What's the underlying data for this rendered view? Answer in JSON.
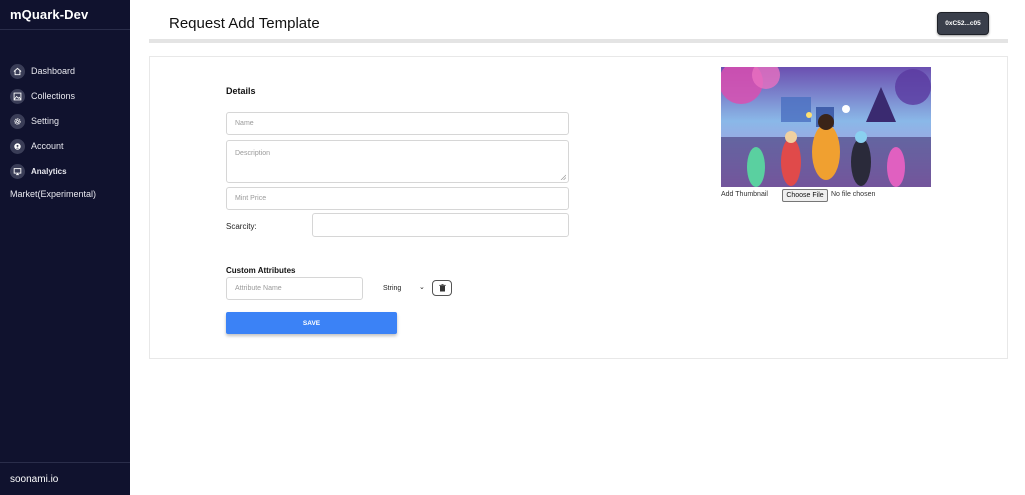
{
  "sidebar": {
    "brand": "mQuark-Dev",
    "items": [
      {
        "label": "Dashboard",
        "icon": "home-icon"
      },
      {
        "label": "Collections",
        "icon": "image-icon"
      },
      {
        "label": "Setting",
        "icon": "gear-icon"
      },
      {
        "label": "Account",
        "icon": "account-icon"
      },
      {
        "label": "Analytics",
        "icon": "monitor-icon"
      }
    ],
    "market": "Market(Experimental)",
    "footer": "soonami.io"
  },
  "header": {
    "title": "Request Add Template",
    "wallet": "0xC52...c05"
  },
  "form": {
    "details_title": "Details",
    "name_placeholder": "Name",
    "description_placeholder": "Description",
    "mint_price_placeholder": "Mint Price",
    "scarcity_label": "Scarcity:",
    "custom_attributes_title": "Custom Attributes",
    "attribute_name_placeholder": "Attribute Name",
    "attribute_type_selected": "String",
    "save_label": "SAVE"
  },
  "thumbnail": {
    "label": "Add Thumbnail",
    "file_button": "Choose File",
    "file_status": "No file chosen"
  },
  "colors": {
    "sidebar_bg": "#10122e",
    "accent": "#3b82f6",
    "wallet_bg": "#3a3f4b"
  }
}
